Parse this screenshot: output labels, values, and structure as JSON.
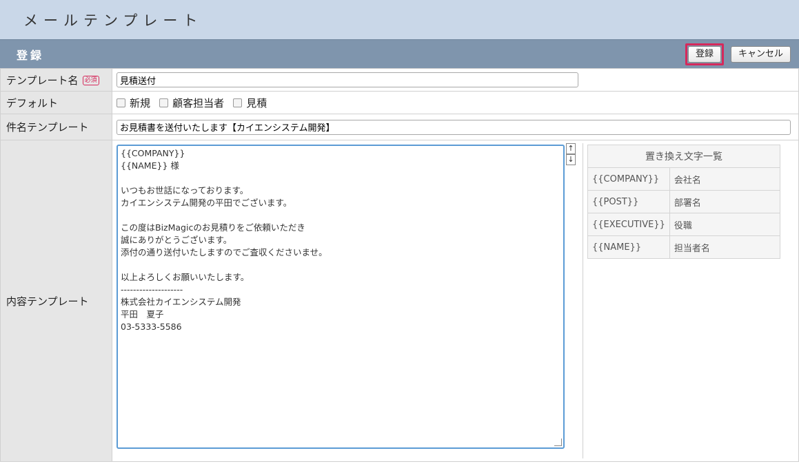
{
  "page": {
    "title": "メールテンプレート"
  },
  "section": {
    "title": "登録"
  },
  "toolbar": {
    "register_label": "登録",
    "cancel_label": "キャンセル"
  },
  "form": {
    "template_name": {
      "label": "テンプレート名",
      "required_badge": "必須",
      "value": "見積送付"
    },
    "default": {
      "label": "デフォルト",
      "options": [
        "新規",
        "顧客担当者",
        "見積"
      ]
    },
    "subject": {
      "label": "件名テンプレート",
      "value": "お見積書を送付いたします【カイエンシステム開発】"
    },
    "body": {
      "label": "内容テンプレート",
      "value": "{{COMPANY}}\n{{NAME}} 様\n\nいつもお世話になっております。\nカイエンシステム開発の平田でございます。\n\nこの度はBizMagicのお見積りをご依頼いただき\n誠にありがとうございます。\n添付の通り送付いたしますのでご査収くださいませ。\n\n以上よろしくお願いいたします。\n--------------------\n株式会社カイエンシステム開発\n平田　夏子\n03-5333-5586"
    }
  },
  "replacements": {
    "title": "置き換え文字一覧",
    "rows": [
      {
        "key": "{{COMPANY}}",
        "desc": "会社名"
      },
      {
        "key": "{{POST}}",
        "desc": "部署名"
      },
      {
        "key": "{{EXECUTIVE}}",
        "desc": "役職"
      },
      {
        "key": "{{NAME}}",
        "desc": "担当者名"
      }
    ]
  },
  "icons": {
    "scroll_up": "arrow-up-icon",
    "scroll_down": "arrow-down-icon"
  },
  "colors": {
    "header_bg": "#c9d7e8",
    "section_bar": "#7f95ad",
    "required": "#d6295b",
    "focus": "#5b9bd5"
  }
}
